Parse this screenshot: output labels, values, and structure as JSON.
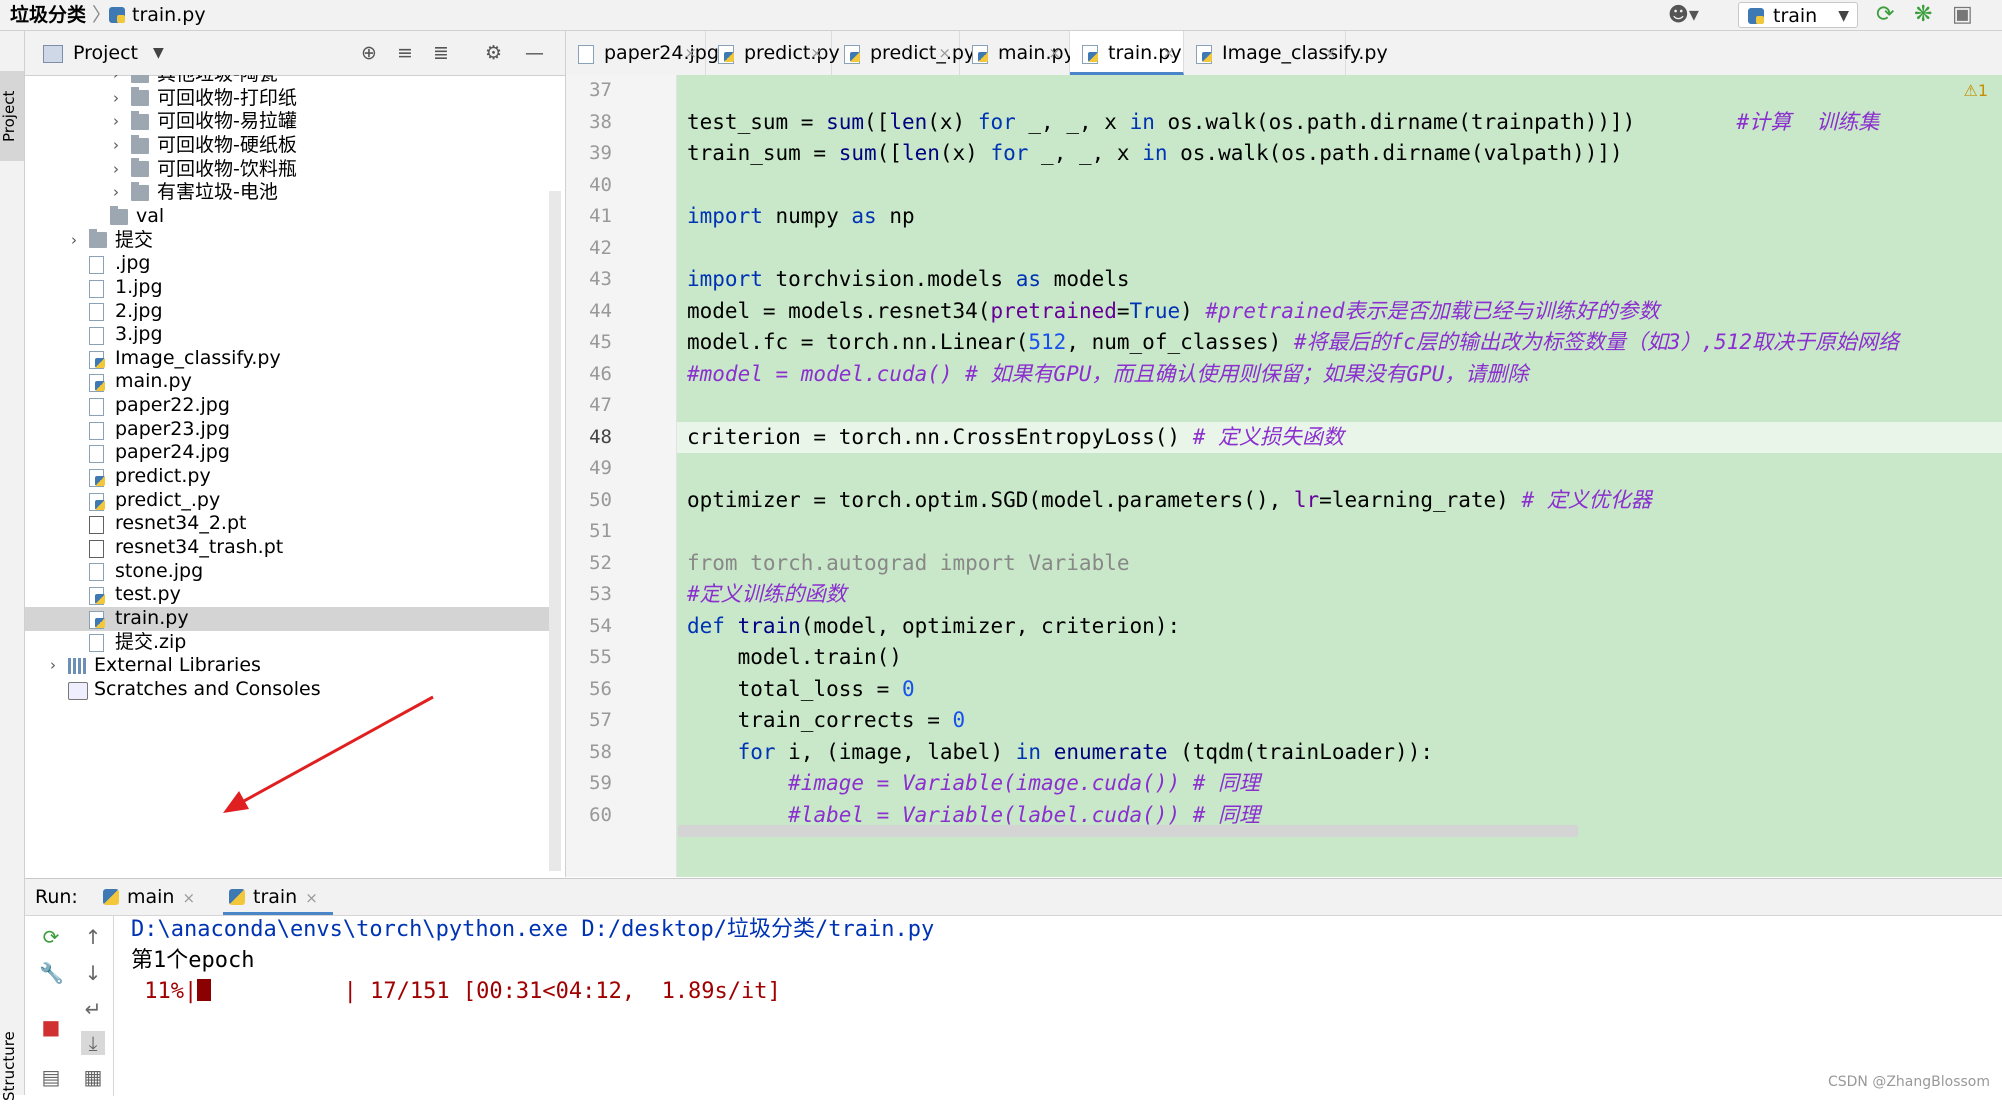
{
  "topbar": {
    "project_name": "垃圾分类",
    "separator": "〉",
    "current_file": "train.py",
    "run_config": "train",
    "run_config_chevron": "▼"
  },
  "left_stripe": {
    "project_label": "Project",
    "structure_label": "Structure"
  },
  "project_panel": {
    "title": "Project",
    "dropdown": "▼",
    "tree": [
      {
        "label": "其他垃圾-陶瓷",
        "type": "folder",
        "indent": 2,
        "arrow": "›"
      },
      {
        "label": "可回收物-打印纸",
        "type": "folder",
        "indent": 2,
        "arrow": "›"
      },
      {
        "label": "可回收物-易拉罐",
        "type": "folder",
        "indent": 2,
        "arrow": "›"
      },
      {
        "label": "可回收物-硬纸板",
        "type": "folder",
        "indent": 2,
        "arrow": "›"
      },
      {
        "label": "可回收物-饮料瓶",
        "type": "folder",
        "indent": 2,
        "arrow": "›"
      },
      {
        "label": "有害垃圾-电池",
        "type": "folder",
        "indent": 2,
        "arrow": "›"
      },
      {
        "label": "val",
        "type": "folder",
        "indent": 1,
        "arrow": ""
      },
      {
        "label": "提交",
        "type": "folder",
        "indent": 0,
        "arrow": "›"
      },
      {
        "label": ".jpg",
        "type": "img",
        "indent": 0,
        "arrow": ""
      },
      {
        "label": "1.jpg",
        "type": "img",
        "indent": 0,
        "arrow": ""
      },
      {
        "label": "2.jpg",
        "type": "img",
        "indent": 0,
        "arrow": ""
      },
      {
        "label": "3.jpg",
        "type": "img",
        "indent": 0,
        "arrow": ""
      },
      {
        "label": "Image_classify.py",
        "type": "py",
        "indent": 0,
        "arrow": ""
      },
      {
        "label": "main.py",
        "type": "py",
        "indent": 0,
        "arrow": ""
      },
      {
        "label": "paper22.jpg",
        "type": "img",
        "indent": 0,
        "arrow": ""
      },
      {
        "label": "paper23.jpg",
        "type": "img",
        "indent": 0,
        "arrow": ""
      },
      {
        "label": "paper24.jpg",
        "type": "img",
        "indent": 0,
        "arrow": ""
      },
      {
        "label": "predict.py",
        "type": "py",
        "indent": 0,
        "arrow": ""
      },
      {
        "label": "predict_.py",
        "type": "py",
        "indent": 0,
        "arrow": ""
      },
      {
        "label": "resnet34_2.pt",
        "type": "pt",
        "indent": 0,
        "arrow": ""
      },
      {
        "label": "resnet34_trash.pt",
        "type": "pt",
        "indent": 0,
        "arrow": ""
      },
      {
        "label": "stone.jpg",
        "type": "img",
        "indent": 0,
        "arrow": ""
      },
      {
        "label": "test.py",
        "type": "py",
        "indent": 0,
        "arrow": ""
      },
      {
        "label": "train.py",
        "type": "py",
        "indent": 0,
        "arrow": "",
        "selected": true
      },
      {
        "label": "提交.zip",
        "type": "zip",
        "indent": 0,
        "arrow": ""
      },
      {
        "label": "External Libraries",
        "type": "lib",
        "indent": -1,
        "arrow": "›"
      },
      {
        "label": "Scratches and Consoles",
        "type": "scratch",
        "indent": -1,
        "arrow": ""
      }
    ]
  },
  "editor": {
    "tabs": [
      {
        "label": "paper24.jpg",
        "type": "img",
        "active": false
      },
      {
        "label": "predict.py",
        "type": "py",
        "active": false
      },
      {
        "label": "predict_.py",
        "type": "py",
        "active": false
      },
      {
        "label": "main.py",
        "type": "py",
        "active": false
      },
      {
        "label": "train.py",
        "type": "py",
        "active": true
      },
      {
        "label": "Image_classify.py",
        "type": "py",
        "active": false
      }
    ],
    "tab_close": "×",
    "warning_badge": "⚠1",
    "highlighted_line": 48,
    "lines": [
      {
        "n": "37",
        "html": ""
      },
      {
        "n": "38",
        "html": "test_sum = <span class='builtin'>sum</span>([<span class='builtin'>len</span>(x) <span class='kw'>for</span> _, _, x <span class='kw'>in</span> os.walk(os.path.dirname(trainpath))])        <span class='cmp'>#计算  训练集</span>"
      },
      {
        "n": "39",
        "html": "train_sum = <span class='builtin'>sum</span>([<span class='builtin'>len</span>(x) <span class='kw'>for</span> _, _, x <span class='kw'>in</span> os.walk(os.path.dirname(valpath))])"
      },
      {
        "n": "40",
        "html": ""
      },
      {
        "n": "41",
        "html": "<span class='kw'>import</span> numpy <span class='kw'>as</span> np"
      },
      {
        "n": "42",
        "html": ""
      },
      {
        "n": "43",
        "html": "<span class='kw'>import</span> torchvision.models <span class='kw'>as</span> models"
      },
      {
        "n": "44",
        "html": "model = models.resnet34(<span class='kwarg'>pretrained</span>=<span class='kw'>True</span>) <span class='cmp'>#pretrained表示是否加载已经与训练好的参数</span>"
      },
      {
        "n": "45",
        "html": "model.fc = torch.nn.Linear(<span class='num'>512</span>, num_of_classes) <span class='cmp'>#将最后的fc层的输出改为标签数量（如3）,512取决于原始网络</span>"
      },
      {
        "n": "46",
        "html": "<span class='cmp'>#model = model.cuda() # 如果有GPU，而且确认使用则保留；如果没有GPU，请删除</span>"
      },
      {
        "n": "47",
        "html": ""
      },
      {
        "n": "48",
        "html": "criterion = torch.nn.CrossEntropyLoss() <span class='cmp'># 定义损失函数</span>"
      },
      {
        "n": "49",
        "html": ""
      },
      {
        "n": "50",
        "html": "optimizer = torch.optim.SGD(model.parameters(), <span class='kwarg'>lr</span>=learning_rate) <span class='cmp'># 定义优化器</span>"
      },
      {
        "n": "51",
        "html": ""
      },
      {
        "n": "52",
        "html": "<span class='gray'>from torch.autograd import Variable</span>"
      },
      {
        "n": "53",
        "html": "<span class='cmp'>#定义训练的函数</span>"
      },
      {
        "n": "54",
        "html": "<span class='kw'>def</span> <span class='fn'>train</span>(model, optimizer, criterion):"
      },
      {
        "n": "55",
        "html": "    model.train()"
      },
      {
        "n": "56",
        "html": "    total_loss = <span class='num'>0</span>"
      },
      {
        "n": "57",
        "html": "    train_corrects = <span class='num'>0</span>"
      },
      {
        "n": "58",
        "html": "    <span class='kw'>for</span> i, (image, label) <span class='kw'>in</span> <span class='builtin'>enumerate</span> (tqdm(trainLoader)):"
      },
      {
        "n": "59",
        "html": "        <span class='cmp'>#image = Variable(image.cuda()) # 同理</span>"
      },
      {
        "n": "60",
        "html": "        <span class='cmp'>#label = Variable(label.cuda()) # 同理</span>"
      }
    ]
  },
  "run_panel": {
    "label": "Run:",
    "tabs": [
      {
        "label": "main",
        "active": false
      },
      {
        "label": "train",
        "active": true
      }
    ],
    "tab_close": "×",
    "console": {
      "command": "D:\\anaconda\\envs\\torch\\python.exe D:/desktop/垃圾分类/train.py",
      "epoch_line": "第1个epoch",
      "progress_percent": " 11%|",
      "progress_fraction": 0.11,
      "progress_tail": "          | 17/151 [00:31<04:12,  1.89s/it]"
    }
  },
  "watermark": "CSDN @ZhangBlossom",
  "colors": {
    "code_background": "#c9e8c9",
    "keyword": "#0033b3",
    "comment_italic": "#8b2fcf",
    "console_progress": "#a00000",
    "annotation_arrow": "#e02020"
  }
}
